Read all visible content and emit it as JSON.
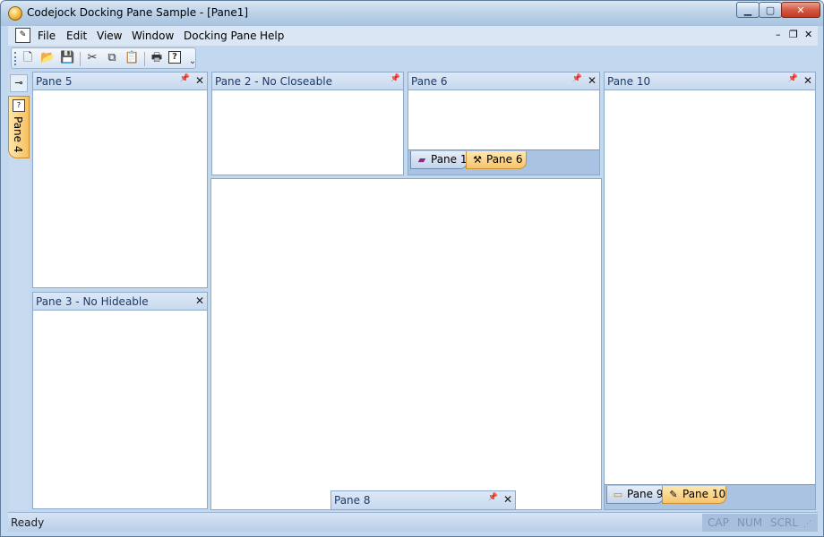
{
  "window": {
    "title": "Codejock Docking Pane Sample - [Pane1]",
    "caption_buttons": {
      "minimize": "▁",
      "maximize": "▢",
      "close": "✕"
    }
  },
  "menubar": {
    "items": [
      "File",
      "Edit",
      "View",
      "Window",
      "Docking Pane",
      "Help"
    ],
    "mdi_buttons": {
      "minimize": "–",
      "restore": "❐",
      "close": "✕"
    }
  },
  "toolbar": {
    "icons": [
      "new-icon",
      "open-icon",
      "save-icon",
      "cut-icon",
      "copy-icon",
      "paste-icon",
      "print-icon",
      "help-icon",
      "overflow-icon"
    ],
    "glyphs": [
      "🗋",
      "📂",
      "💾",
      "✂",
      "⧉",
      "📋",
      "🖶",
      "?",
      "⌄"
    ]
  },
  "autohide": {
    "pin_glyph": "⊸",
    "pane4": {
      "label": "Pane 4"
    }
  },
  "panes": {
    "pane5": {
      "title": "Pane 5",
      "pin": "📌",
      "close": "✕"
    },
    "pane2": {
      "title": "Pane 2 - No Closeable",
      "pin": "📌"
    },
    "pane6": {
      "title": "Pane 6",
      "pin": "📌",
      "close": "✕",
      "tabs": [
        {
          "label": "Pane 1",
          "active": false
        },
        {
          "label": "Pane 6",
          "active": true
        }
      ]
    },
    "pane10": {
      "title": "Pane 10",
      "pin": "📌",
      "close": "✕",
      "tabs": [
        {
          "label": "Pane 9",
          "active": false
        },
        {
          "label": "Pane 10",
          "active": true
        }
      ]
    },
    "pane3": {
      "title": "Pane 3 - No Hideable",
      "close": "✕"
    },
    "pane8": {
      "title": "Pane 8",
      "pin": "📌",
      "close": "✕"
    }
  },
  "statusbar": {
    "text": "Ready",
    "indicators": [
      "CAP",
      "NUM",
      "SCRL"
    ],
    "grip": "⋰"
  }
}
